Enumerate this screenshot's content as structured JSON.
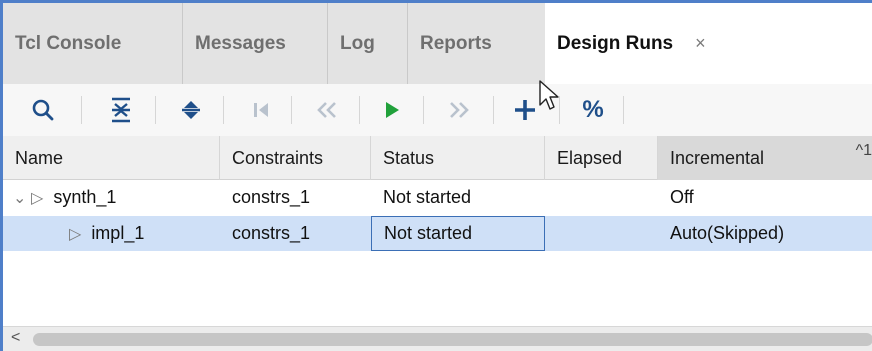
{
  "tabs": [
    {
      "label": "Tcl Console"
    },
    {
      "label": "Messages"
    },
    {
      "label": "Log"
    },
    {
      "label": "Reports"
    },
    {
      "label": "Design Runs",
      "active": true,
      "close": "×"
    }
  ],
  "toolbar": {
    "icons": [
      "search-icon",
      "collapse-all-icon",
      "expand-all-icon",
      "first-icon",
      "previous-icon",
      "run-icon",
      "next-icon",
      "add-icon",
      "percent-icon"
    ],
    "percent_label": "%"
  },
  "table": {
    "columns": [
      "Name",
      "Constraints",
      "Status",
      "Elapsed",
      "Incremental"
    ],
    "sort_indicator": "^1",
    "rows": [
      {
        "name": "synth_1",
        "constraints": "constrs_1",
        "status": "Not started",
        "elapsed": "",
        "incremental": "Off"
      },
      {
        "name": "impl_1",
        "constraints": "constrs_1",
        "status": "Not started",
        "elapsed": "",
        "incremental": "Auto(Skipped)"
      }
    ]
  },
  "scrollbar": {
    "left_arrow": "<"
  },
  "colors": {
    "accent": "#4f7fc9",
    "selection": "#cfe0f7",
    "run_green": "#21a13b"
  }
}
